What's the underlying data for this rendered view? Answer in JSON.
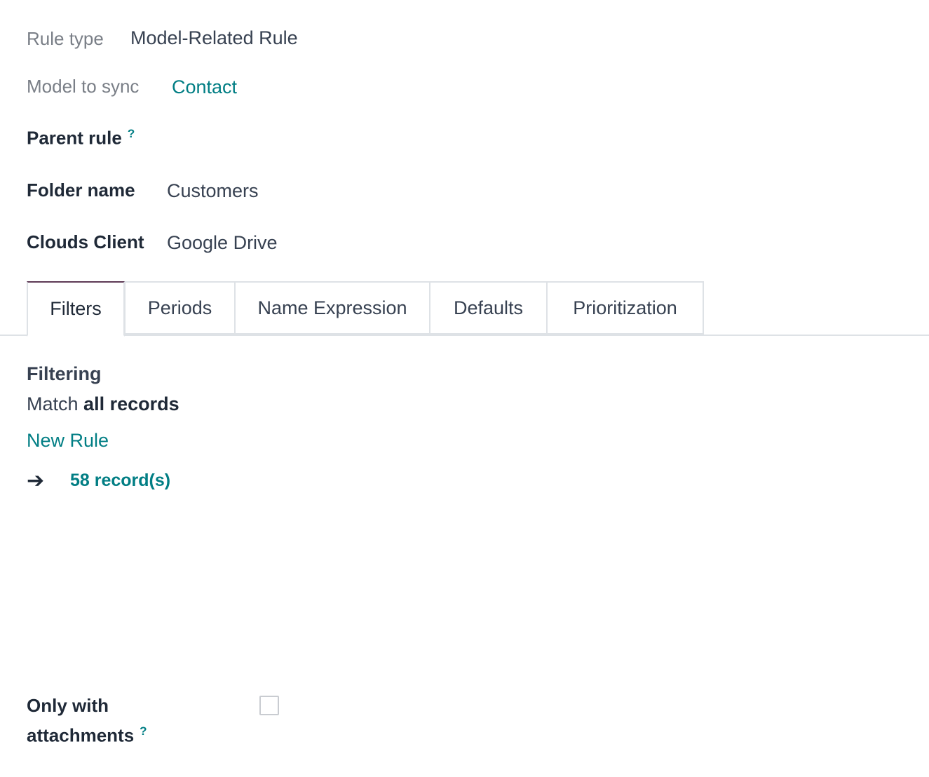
{
  "fields": {
    "rule_type": {
      "label": "Rule type",
      "value": "Model-Related Rule"
    },
    "model_to_sync": {
      "label": "Model to sync",
      "value": "Contact"
    },
    "parent_rule": {
      "label": "Parent rule",
      "help": "?"
    },
    "folder_name": {
      "label": "Folder name",
      "value": "Customers"
    },
    "clouds_client": {
      "label": "Clouds Client",
      "value": "Google Drive"
    },
    "only_with_attachments": {
      "label_line1": "Only with",
      "label_line2": "attachments",
      "help": "?",
      "checked": false
    }
  },
  "tabs": [
    {
      "label": "Filters",
      "active": true
    },
    {
      "label": "Periods",
      "active": false
    },
    {
      "label": "Name Expression",
      "active": false
    },
    {
      "label": "Defaults",
      "active": false
    },
    {
      "label": "Prioritization",
      "active": false
    }
  ],
  "filtering": {
    "title": "Filtering",
    "match_prefix": "Match",
    "match_value": "all records",
    "new_rule_label": "New Rule",
    "arrow_icon": "arrow-right-icon",
    "records_label": "58 record(s)"
  },
  "colors": {
    "link": "#017e84",
    "active_tab_accent": "#5e3a55",
    "border": "#dee2e6"
  }
}
